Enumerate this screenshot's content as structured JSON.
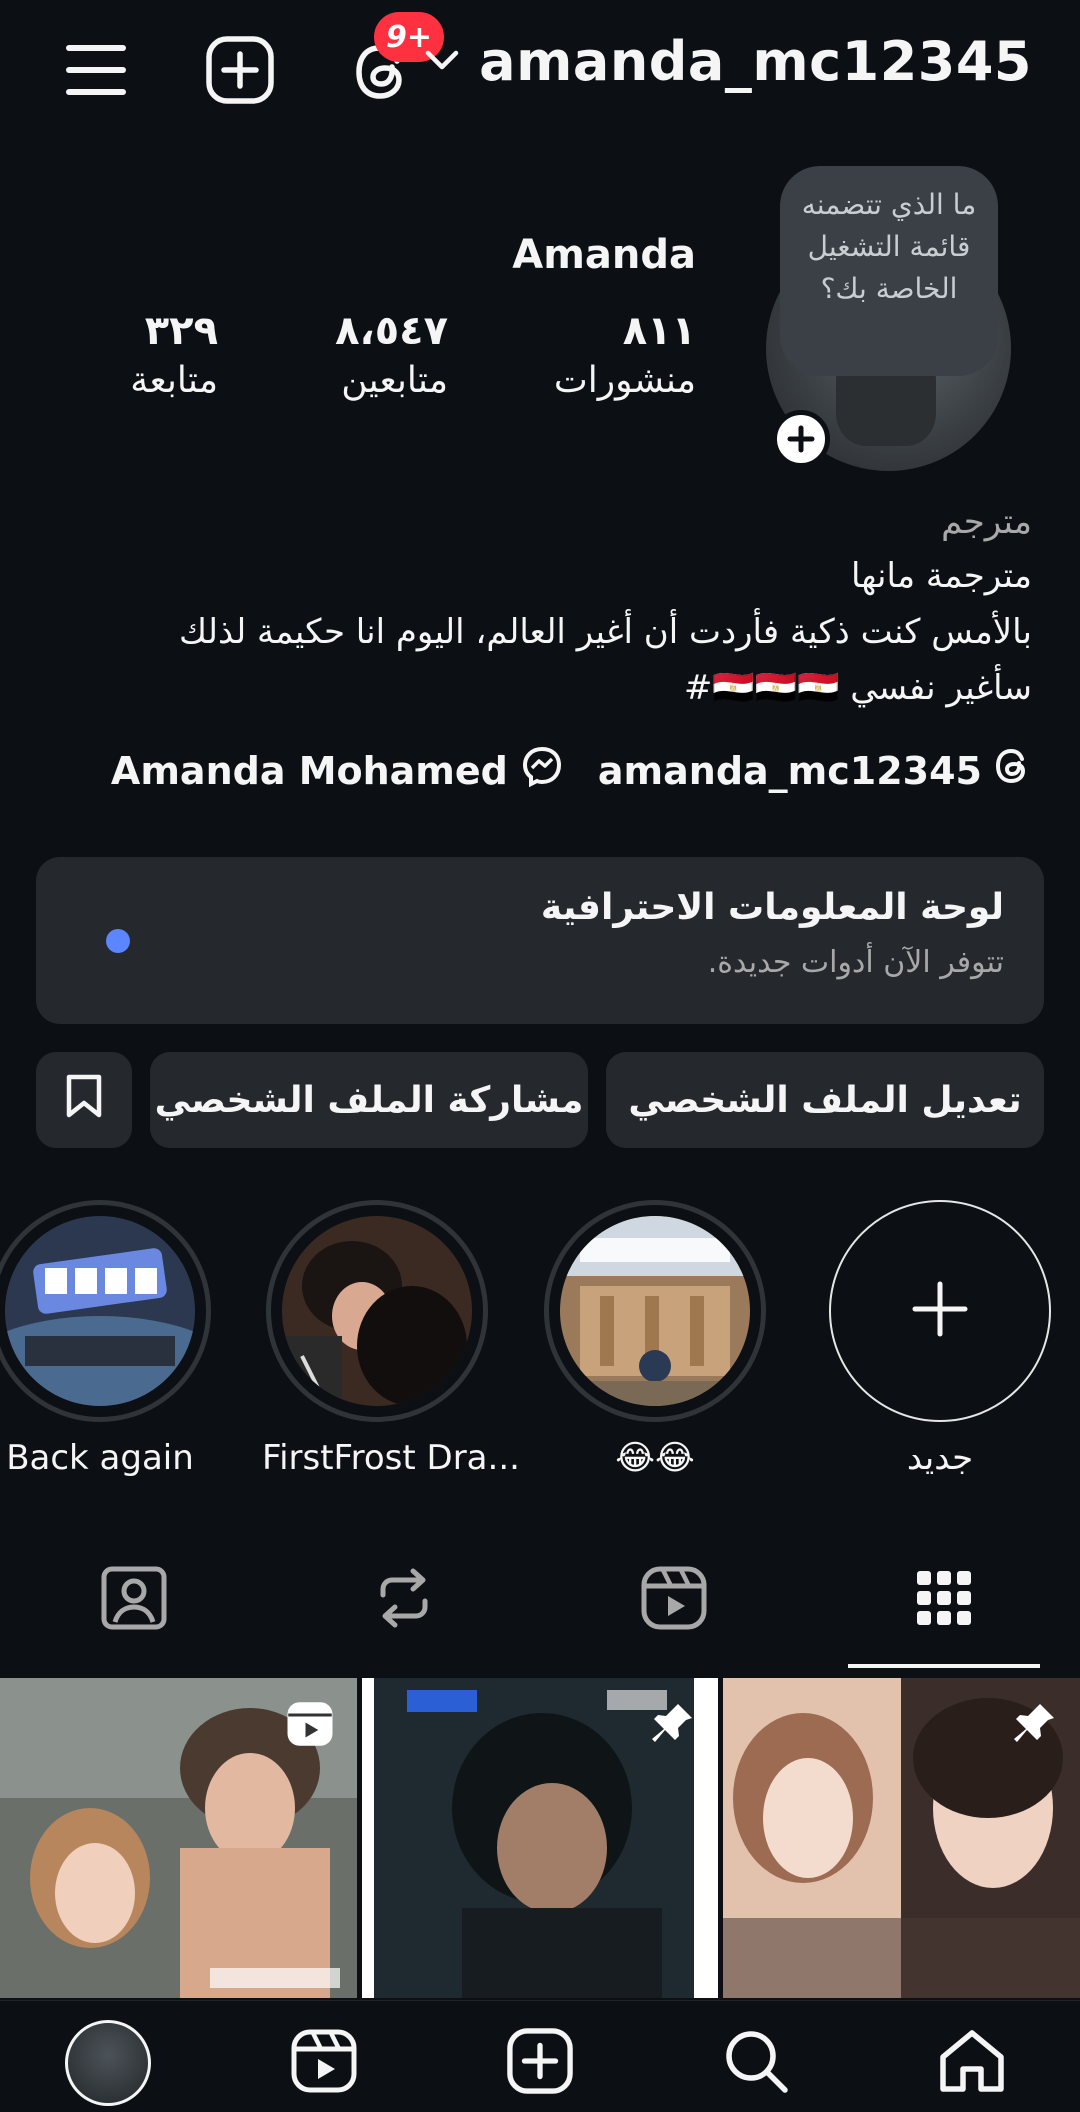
{
  "header": {
    "username": "amanda_mc12345",
    "notifications_badge": "9+",
    "icons": {
      "menu": "hamburger-menu-icon",
      "create": "plus-square-icon",
      "threads": "threads-icon",
      "chevron": "chevron-down-icon"
    }
  },
  "profile": {
    "note": "ما الذي تتضمنه قائمة التشغيل الخاصة بك؟",
    "display_name": "Amanda",
    "stats": {
      "posts": {
        "value": "٨١١",
        "label": "منشورات"
      },
      "followers": {
        "value": "٨،٥٤٧",
        "label": "متابعين"
      },
      "following": {
        "value": "٣٢٩",
        "label": "متابعة"
      }
    },
    "category": "مترجم",
    "bio_lines": [
      "مترجمة مانها",
      "بالأمس كنت ذكية فأردت أن أغير العالم، اليوم انا حكيمة لذلك",
      "سأغير نفسي 🇪🇬🇪🇬🇪🇬#"
    ],
    "links": {
      "threads_handle": "amanda_mc12345",
      "facebook_name": "Amanda Mohamed"
    }
  },
  "dashboard": {
    "title": "لوحة المعلومات الاحترافية",
    "subtitle": "تتوفر الآن أدوات جديدة.",
    "dot_color": "#5b86ff"
  },
  "actions": {
    "edit_profile": "تعديل الملف الشخصي",
    "share_profile": "مشاركة الملف الشخصي"
  },
  "highlights": [
    {
      "label": "جديد",
      "type": "new"
    },
    {
      "label": "😂😂"
    },
    {
      "label": "FirstFrost Dra..."
    },
    {
      "label": "Back again"
    }
  ],
  "tabs": [
    "grid",
    "reels",
    "reposts",
    "tagged"
  ],
  "colors": {
    "background": "#0c1014",
    "card": "#25292e",
    "badge": "#ff3040",
    "accent_dot": "#5b86ff"
  }
}
